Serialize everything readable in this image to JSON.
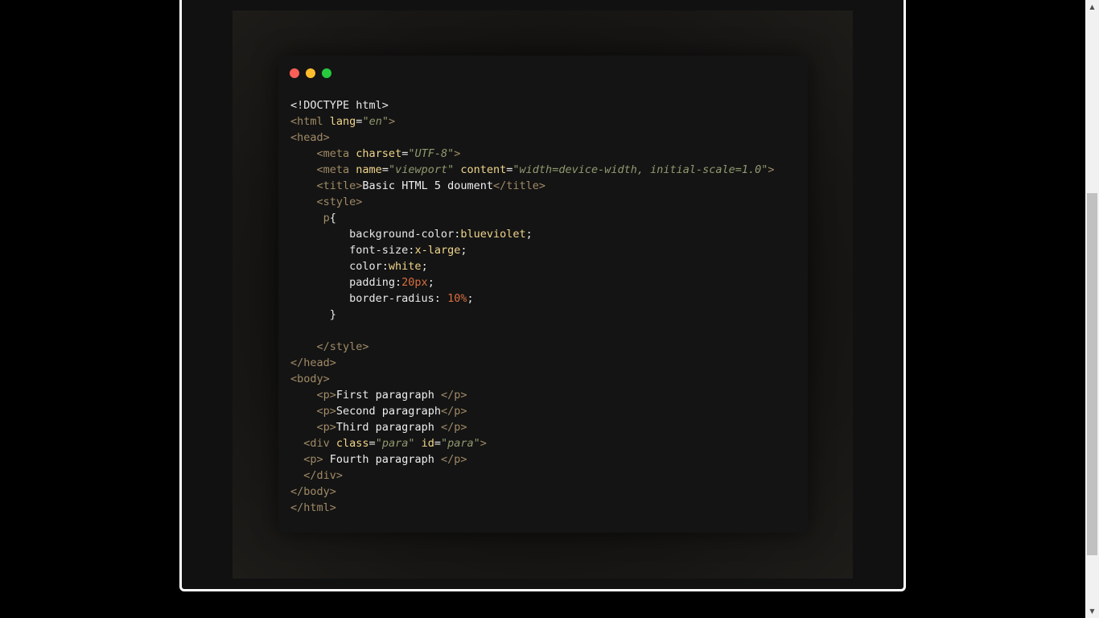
{
  "colors": {
    "page_background": "#000000",
    "frame_border": "#ffffff",
    "code_window_background": "#141414",
    "dot_red": "#ff5f56",
    "dot_yellow": "#ffbd2e",
    "dot_green": "#27c93f",
    "tag": "#a08a66",
    "attribute": "#f0d58a",
    "string": "#8f9a6f",
    "number": "#d96f3f"
  },
  "window_controls": [
    {
      "name": "close-dot",
      "color": "#ff5f56"
    },
    {
      "name": "minimize-dot",
      "color": "#ffbd2e"
    },
    {
      "name": "maximize-dot",
      "color": "#27c93f"
    }
  ],
  "code_lines": [
    [
      {
        "t": "plain",
        "v": "<!DOCTYPE html>"
      }
    ],
    [
      {
        "t": "tag",
        "v": "<html "
      },
      {
        "t": "attr",
        "v": "lang"
      },
      {
        "t": "punc",
        "v": "="
      },
      {
        "t": "str",
        "v": "\"en\""
      },
      {
        "t": "tag",
        "v": ">"
      }
    ],
    [
      {
        "t": "tag",
        "v": "<head>"
      }
    ],
    [
      {
        "t": "plain",
        "v": "    "
      },
      {
        "t": "tag",
        "v": "<meta "
      },
      {
        "t": "attr",
        "v": "charset"
      },
      {
        "t": "punc",
        "v": "="
      },
      {
        "t": "str",
        "v": "\"UTF-8\""
      },
      {
        "t": "tag",
        "v": ">"
      }
    ],
    [
      {
        "t": "plain",
        "v": "    "
      },
      {
        "t": "tag",
        "v": "<meta "
      },
      {
        "t": "attr",
        "v": "name"
      },
      {
        "t": "punc",
        "v": "="
      },
      {
        "t": "str",
        "v": "\"viewport\""
      },
      {
        "t": "plain",
        "v": " "
      },
      {
        "t": "attr",
        "v": "content"
      },
      {
        "t": "punc",
        "v": "="
      },
      {
        "t": "str",
        "v": "\"width=device-width, initial-scale=1.0\""
      },
      {
        "t": "tag",
        "v": ">"
      }
    ],
    [
      {
        "t": "plain",
        "v": "    "
      },
      {
        "t": "tag",
        "v": "<title>"
      },
      {
        "t": "text",
        "v": "Basic HTML 5 doument"
      },
      {
        "t": "tag",
        "v": "</title>"
      }
    ],
    [
      {
        "t": "plain",
        "v": "    "
      },
      {
        "t": "tag",
        "v": "<style>"
      }
    ],
    [
      {
        "t": "plain",
        "v": "     "
      },
      {
        "t": "tag",
        "v": "p"
      },
      {
        "t": "punc",
        "v": "{"
      }
    ],
    [
      {
        "t": "plain",
        "v": "         background-color:"
      },
      {
        "t": "kw",
        "v": "blueviolet"
      },
      {
        "t": "punc",
        "v": ";"
      }
    ],
    [
      {
        "t": "plain",
        "v": "         font-size:"
      },
      {
        "t": "kw",
        "v": "x-large"
      },
      {
        "t": "punc",
        "v": ";"
      }
    ],
    [
      {
        "t": "plain",
        "v": "         color:"
      },
      {
        "t": "kw",
        "v": "white"
      },
      {
        "t": "punc",
        "v": ";"
      }
    ],
    [
      {
        "t": "plain",
        "v": "         padding:"
      },
      {
        "t": "num",
        "v": "20px"
      },
      {
        "t": "punc",
        "v": ";"
      }
    ],
    [
      {
        "t": "plain",
        "v": "         border-radius: "
      },
      {
        "t": "num",
        "v": "10%"
      },
      {
        "t": "punc",
        "v": ";"
      }
    ],
    [
      {
        "t": "plain",
        "v": "      }"
      }
    ],
    [
      {
        "t": "plain",
        "v": ""
      }
    ],
    [
      {
        "t": "plain",
        "v": "    "
      },
      {
        "t": "tag",
        "v": "</style>"
      }
    ],
    [
      {
        "t": "tag",
        "v": "</head>"
      }
    ],
    [
      {
        "t": "tag",
        "v": "<body>"
      }
    ],
    [
      {
        "t": "plain",
        "v": "    "
      },
      {
        "t": "tag",
        "v": "<p>"
      },
      {
        "t": "text",
        "v": "First paragraph "
      },
      {
        "t": "tag",
        "v": "</p>"
      }
    ],
    [
      {
        "t": "plain",
        "v": "    "
      },
      {
        "t": "tag",
        "v": "<p>"
      },
      {
        "t": "text",
        "v": "Second paragraph"
      },
      {
        "t": "tag",
        "v": "</p>"
      }
    ],
    [
      {
        "t": "plain",
        "v": "    "
      },
      {
        "t": "tag",
        "v": "<p>"
      },
      {
        "t": "text",
        "v": "Third paragraph "
      },
      {
        "t": "tag",
        "v": "</p>"
      }
    ],
    [
      {
        "t": "plain",
        "v": "  "
      },
      {
        "t": "tag",
        "v": "<div "
      },
      {
        "t": "attr",
        "v": "class"
      },
      {
        "t": "punc",
        "v": "="
      },
      {
        "t": "str",
        "v": "\"para\""
      },
      {
        "t": "plain",
        "v": " "
      },
      {
        "t": "attr",
        "v": "id"
      },
      {
        "t": "punc",
        "v": "="
      },
      {
        "t": "str",
        "v": "\"para\""
      },
      {
        "t": "tag",
        "v": ">"
      }
    ],
    [
      {
        "t": "plain",
        "v": "  "
      },
      {
        "t": "tag",
        "v": "<p>"
      },
      {
        "t": "text",
        "v": " Fourth paragraph "
      },
      {
        "t": "tag",
        "v": "</p>"
      }
    ],
    [
      {
        "t": "plain",
        "v": "  "
      },
      {
        "t": "tag",
        "v": "</div>"
      }
    ],
    [
      {
        "t": "tag",
        "v": "</body>"
      }
    ],
    [
      {
        "t": "tag",
        "v": "</html>"
      }
    ]
  ],
  "scrollbar": {
    "up_arrow_icon": "triangle-up",
    "down_arrow_icon": "triangle-down"
  }
}
